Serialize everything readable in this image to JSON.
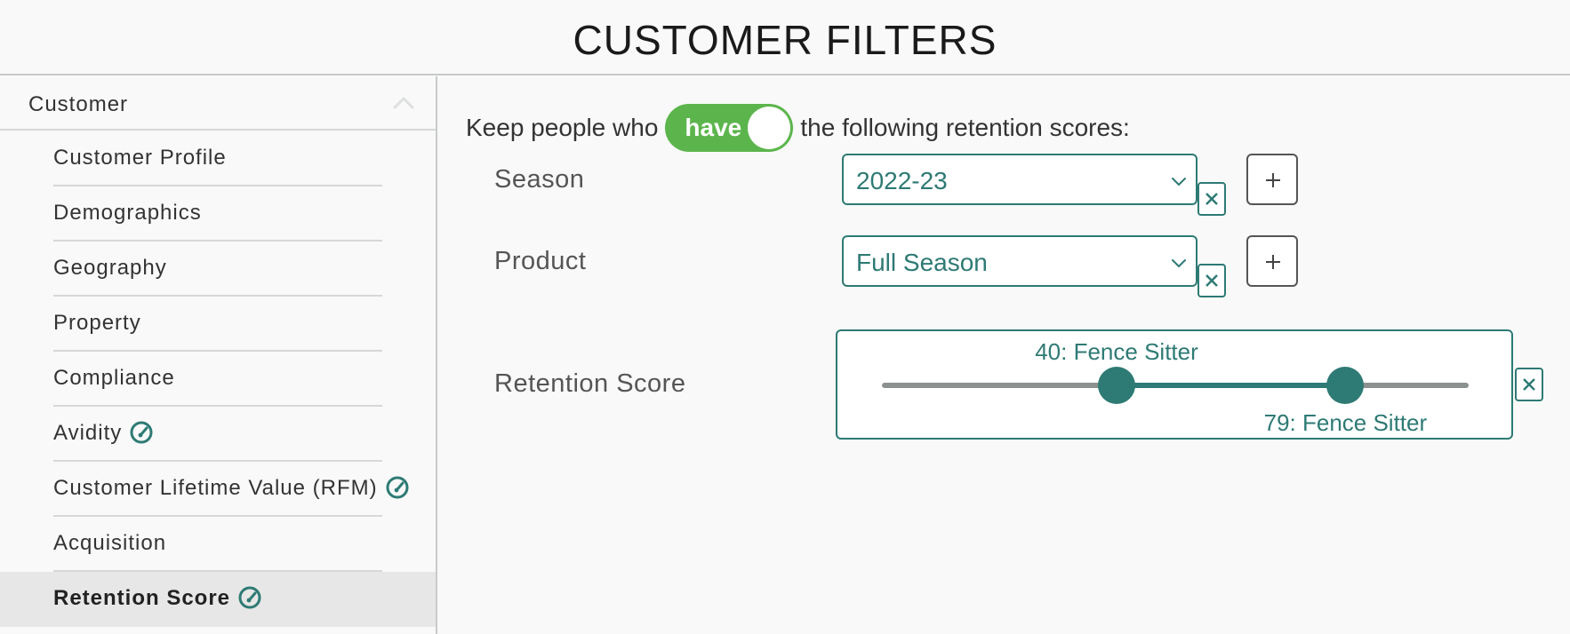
{
  "header": {
    "title": "CUSTOMER FILTERS"
  },
  "sidebar": {
    "category": "Customer",
    "items": [
      {
        "label": "Customer Profile",
        "gauge": false,
        "active": false
      },
      {
        "label": "Demographics",
        "gauge": false,
        "active": false
      },
      {
        "label": "Geography",
        "gauge": false,
        "active": false
      },
      {
        "label": "Property",
        "gauge": false,
        "active": false
      },
      {
        "label": "Compliance",
        "gauge": false,
        "active": false
      },
      {
        "label": "Avidity",
        "gauge": true,
        "active": false
      },
      {
        "label": "Customer Lifetime Value (RFM)",
        "gauge": true,
        "active": false
      },
      {
        "label": "Acquisition",
        "gauge": false,
        "active": false
      },
      {
        "label": "Retention Score",
        "gauge": true,
        "active": true
      }
    ]
  },
  "filter": {
    "intro_prefix": "Keep people who",
    "toggle_label": "have",
    "intro_suffix": "the following retention scores:",
    "season": {
      "label": "Season",
      "value": "2022-23"
    },
    "product": {
      "label": "Product",
      "value": "Full Season"
    },
    "retention": {
      "label": "Retention Score",
      "min": 0,
      "max": 100,
      "low": 40,
      "high": 79,
      "low_label": "40: Fence Sitter",
      "high_label": "79: Fence Sitter"
    }
  },
  "colors": {
    "accent": "#2e7a74",
    "toggle_on": "#5cb54c",
    "track": "#8b918f"
  },
  "icons": {
    "collapse": "chevron-up-icon",
    "dropdown": "chevron-down-icon",
    "remove": "close-icon",
    "add": "plus-icon",
    "gauge": "gauge-icon"
  }
}
